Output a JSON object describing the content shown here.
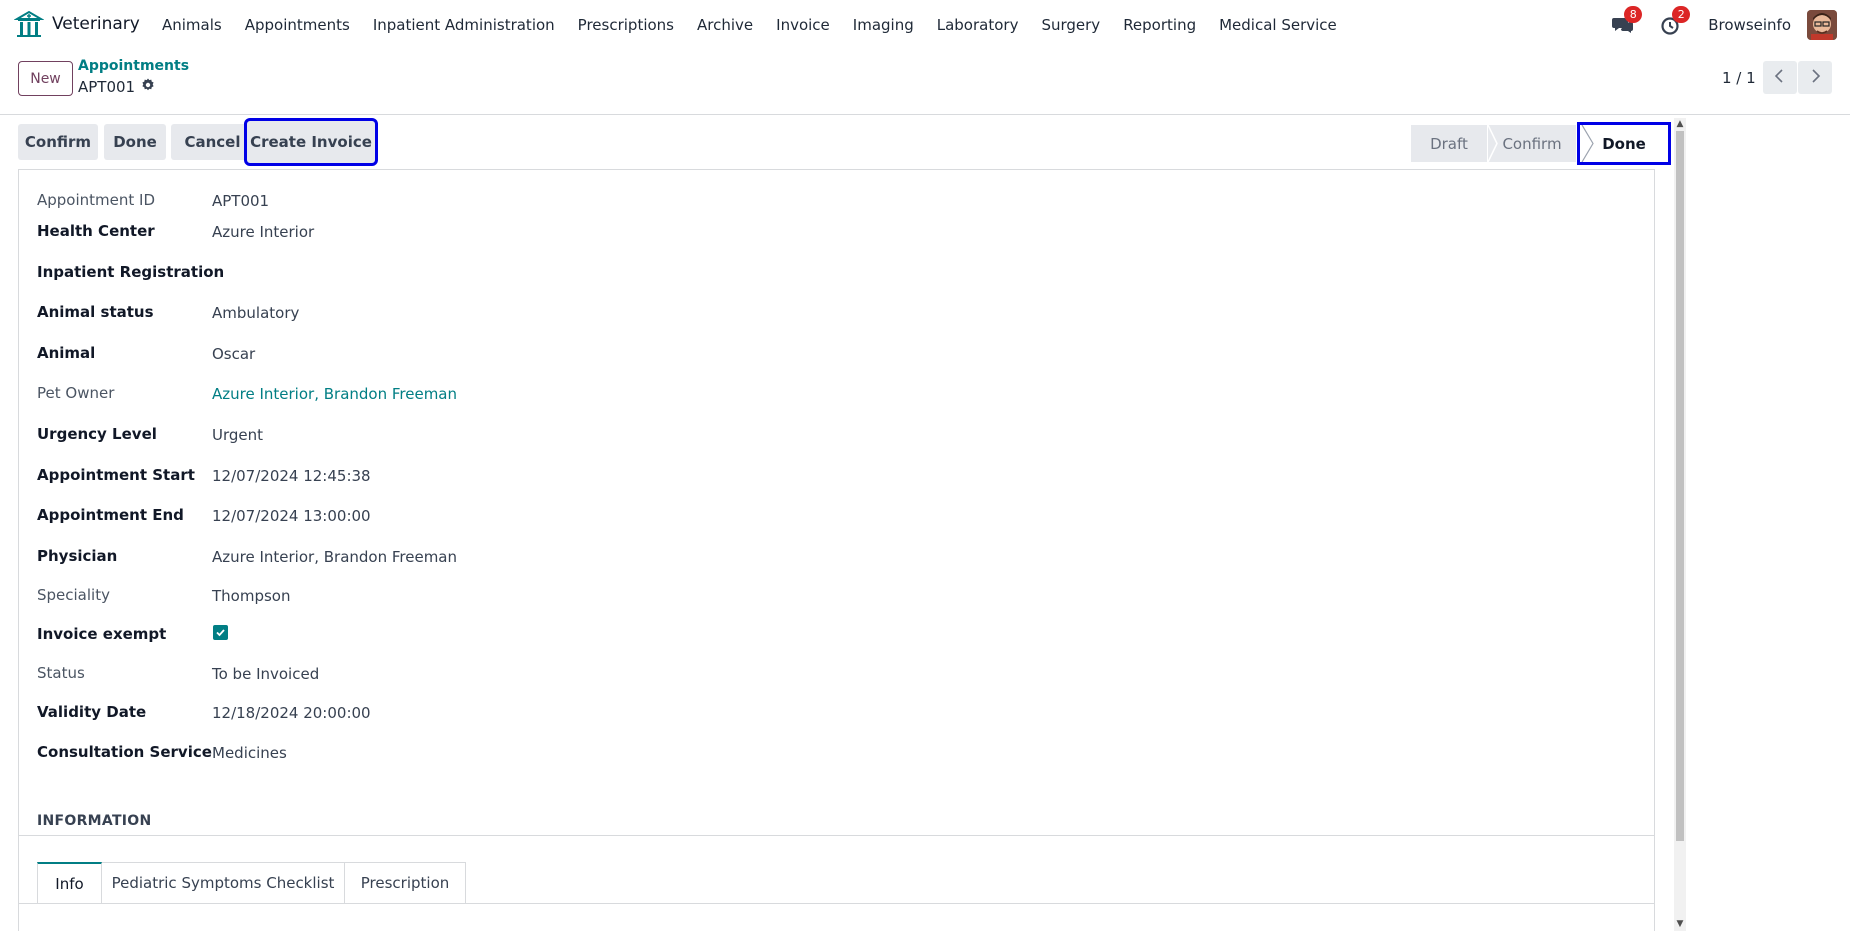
{
  "app": {
    "name": "Veterinary"
  },
  "menu": [
    "Animals",
    "Appointments",
    "Inpatient Administration",
    "Prescriptions",
    "Archive",
    "Invoice",
    "Imaging",
    "Laboratory",
    "Surgery",
    "Reporting",
    "Medical Service"
  ],
  "systray": {
    "messages_count": "8",
    "activities_count": "2",
    "company": "Browseinfo"
  },
  "control_panel": {
    "new_label": "New",
    "breadcrumb_parent": "Appointments",
    "record_name": "APT001",
    "pager": "1 / 1"
  },
  "actions": {
    "confirm": "Confirm",
    "done": "Done",
    "cancel": "Cancel",
    "create_invoice": "Create Invoice"
  },
  "stages": {
    "draft": "Draft",
    "confirm": "Confirm",
    "done": "Done"
  },
  "fields": {
    "appointment_id": {
      "label": "Appointment ID",
      "value": "APT001"
    },
    "health_center": {
      "label": "Health Center",
      "value": "Azure Interior"
    },
    "inpatient_registration": {
      "label": "Inpatient Registration",
      "value": ""
    },
    "animal_status": {
      "label": "Animal status",
      "value": "Ambulatory"
    },
    "animal": {
      "label": "Animal",
      "value": "Oscar"
    },
    "pet_owner": {
      "label": "Pet Owner",
      "value": "Azure Interior, Brandon Freeman"
    },
    "urgency_level": {
      "label": "Urgency Level",
      "value": "Urgent"
    },
    "appointment_start": {
      "label": "Appointment Start",
      "value": "12/07/2024 12:45:38"
    },
    "appointment_end": {
      "label": "Appointment End",
      "value": "12/07/2024 13:00:00"
    },
    "physician": {
      "label": "Physician",
      "value": "Azure Interior, Brandon Freeman"
    },
    "speciality": {
      "label": "Speciality",
      "value": "Thompson"
    },
    "invoice_exempt": {
      "label": "Invoice exempt",
      "checked": true
    },
    "status": {
      "label": "Status",
      "value": "To be Invoiced"
    },
    "validity_date": {
      "label": "Validity Date",
      "value": "12/18/2024 20:00:00"
    },
    "consultation_service": {
      "label": "Consultation Service",
      "value": "Medicines"
    }
  },
  "section": {
    "title": "INFORMATION"
  },
  "tabs": [
    "Info",
    "Pediatric Symptoms Checklist",
    "Prescription"
  ],
  "colors": {
    "accent": "#017e84",
    "brand": "#71415f",
    "highlight": "#0000e6",
    "badge": "#dc2626"
  }
}
